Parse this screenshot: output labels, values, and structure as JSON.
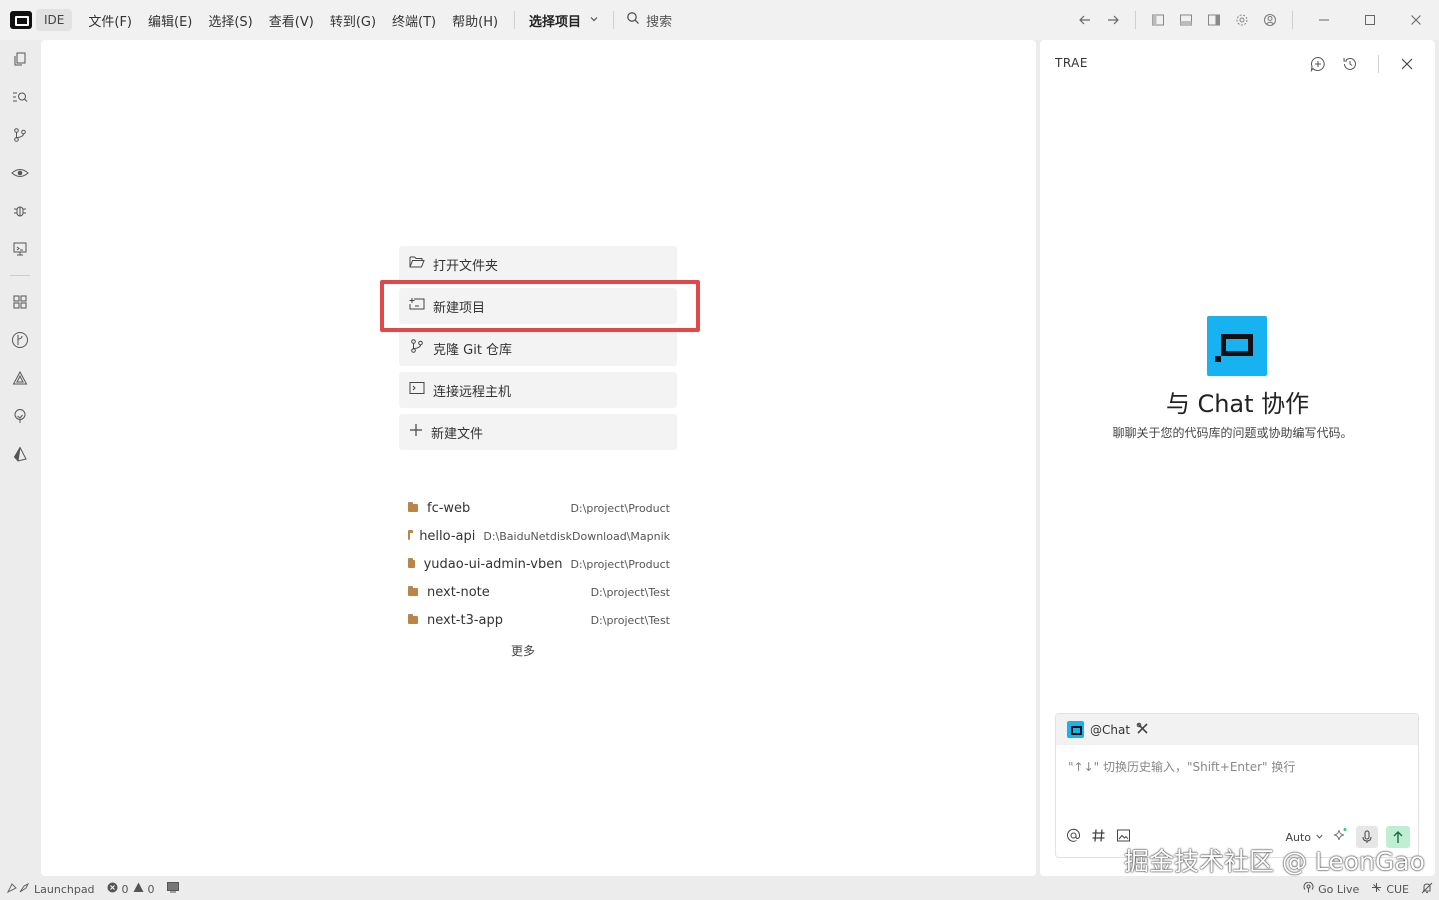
{
  "titlebar": {
    "ide_label": "IDE",
    "menu": [
      "文件(F)",
      "编辑(E)",
      "选择(S)",
      "查看(V)",
      "转到(G)",
      "终端(T)",
      "帮助(H)"
    ],
    "project_select": "选择项目",
    "search": "搜索"
  },
  "actions": [
    {
      "label": "打开文件夹",
      "icon": "folder-open-icon"
    },
    {
      "label": "新建项目",
      "icon": "new-project-icon"
    },
    {
      "label": "克隆 Git 仓库",
      "icon": "git-branch-icon"
    },
    {
      "label": "连接远程主机",
      "icon": "remote-terminal-icon"
    },
    {
      "label": "新建文件",
      "icon": "plus-icon"
    }
  ],
  "recents": [
    {
      "name": "fc-web",
      "path": "D:\\project\\Product"
    },
    {
      "name": "hello-api",
      "path": "D:\\BaiduNetdiskDownload\\Mapnik"
    },
    {
      "name": "yudao-ui-admin-vben",
      "path": "D:\\project\\Product"
    },
    {
      "name": "next-note",
      "path": "D:\\project\\Test"
    },
    {
      "name": "next-t3-app",
      "path": "D:\\project\\Test"
    }
  ],
  "more_label": "更多",
  "chat": {
    "title": "TRAE",
    "heading": "与 Chat 协作",
    "subtitle": "聊聊关于您的代码库的问题或协助编写代码。",
    "agent_label": "@Chat",
    "placeholder": "\"↑↓\" 切换历史输入，\"Shift+Enter\" 换行",
    "mode": "Auto"
  },
  "watermark": "掘金技术社区 @ LeonGao",
  "status": {
    "launchpad": "Launchpad",
    "errors": "0",
    "warnings": "0",
    "go_live": "Go Live",
    "cue": "CUE"
  },
  "colors": {
    "accent": "#17b3f0",
    "highlight": "#e24848",
    "send": "#bfeed3"
  }
}
